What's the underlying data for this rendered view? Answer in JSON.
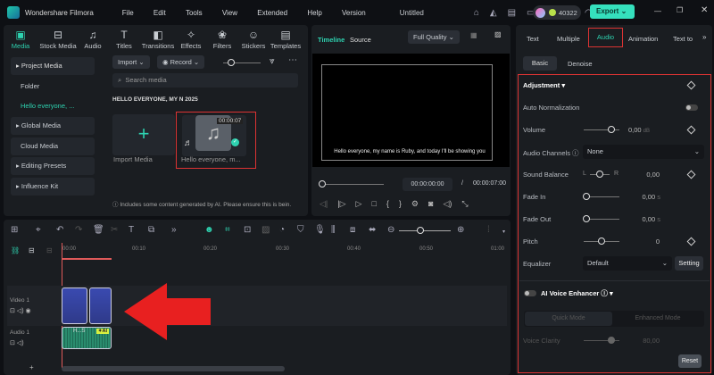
{
  "titlebar": {
    "app": "Wondershare Filmora",
    "menu": [
      "File",
      "Edit",
      "Tools",
      "View",
      "Extended",
      "Help",
      "Version"
    ],
    "doc_title": "Untitled",
    "credits": "40322",
    "export": "Export"
  },
  "media_tabs": [
    {
      "label": "Media",
      "icon": "media-icon"
    },
    {
      "label": "Stock Media",
      "icon": "stock-icon"
    },
    {
      "label": "Audio",
      "icon": "music-icon"
    },
    {
      "label": "Titles",
      "icon": "text-icon"
    },
    {
      "label": "Transitions",
      "icon": "transition-icon"
    },
    {
      "label": "Effects",
      "icon": "effects-icon"
    },
    {
      "label": "Filters",
      "icon": "filter-icon"
    },
    {
      "label": "Stickers",
      "icon": "sticker-icon"
    },
    {
      "label": "Templates",
      "icon": "template-icon"
    }
  ],
  "sidebar": [
    "Project Media",
    "Folder",
    "Hello everyone, ...",
    "Global Media",
    "Cloud Media",
    "Editing Presets",
    "Influence Kit"
  ],
  "media": {
    "import": "Import",
    "record": "Record",
    "search_placeholder": "Search media",
    "folder_title": "HELLO EVERYONE, MY N 2025",
    "import_media": "Import Media",
    "clip_name": "Hello everyone, m...",
    "clip_duration": "00:00:07",
    "notice": "Includes some content generated by AI. Please ensure this is bein."
  },
  "preview": {
    "tab_timeline": "Timeline",
    "tab_source": "Source",
    "quality": "Full Quality",
    "subtitle": "Hello everyone, my name is Ruby, and today I'll be showing you",
    "current_time": "00:00:00:00",
    "separator": "/",
    "total_time": "00:00:07:00"
  },
  "props": {
    "tabs": [
      "Text",
      "Multiple",
      "Audio",
      "Animation",
      "Text to"
    ],
    "subtabs": [
      "Basic",
      "Denoise"
    ],
    "section": "Adjustment",
    "auto_norm": "Auto Normalization",
    "volume": "Volume",
    "volume_val": "0,00",
    "volume_unit": "dB",
    "channels": "Audio Channels",
    "channels_val": "None",
    "balance": "Sound Balance",
    "bal_l": "L",
    "bal_r": "R",
    "balance_val": "0,00",
    "fade_in": "Fade In",
    "fade_in_val": "0,00",
    "fade_out": "Fade Out",
    "fade_out_val": "0,00",
    "sec": "s",
    "pitch": "Pitch",
    "pitch_val": "0",
    "equalizer": "Equalizer",
    "eq_val": "Default",
    "setting": "Setting",
    "ai_voice": "AI Voice Enhancer",
    "quick": "Quick Mode",
    "enhanced": "Enhanced Mode",
    "clarity": "Voice Clarity",
    "clarity_val": "80,00",
    "reset": "Reset"
  },
  "timeline": {
    "ticks": [
      "00:00",
      "00:10",
      "00:20",
      "00:30",
      "00:40",
      "00:50",
      "01:00"
    ],
    "video_track": "Video 1",
    "audio_track": "Audio 1",
    "audio_clip": "H...S",
    "ai_badge": "AI"
  }
}
